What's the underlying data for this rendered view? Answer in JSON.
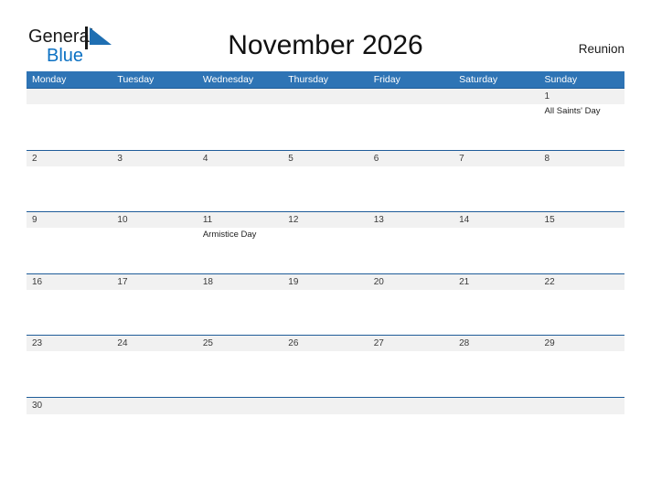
{
  "brand": {
    "word_one": "General",
    "word_two": "Blue",
    "flag_icon": "blue-flag-triangle-icon",
    "accent_dark": "#1a1a1a",
    "accent_blue": "#0c71c3"
  },
  "header": {
    "title": "November 2026",
    "region": "Reunion"
  },
  "theme": {
    "header_blue": "#2e74b5",
    "row_divider_blue": "#1f5c99",
    "date_band_gray": "#f1f1f1",
    "cell_white": "#ffffff",
    "date_text": "#3a3a3a",
    "event_text": "#222222"
  },
  "calendar": {
    "weekday_headers": [
      "Monday",
      "Tuesday",
      "Wednesday",
      "Thursday",
      "Friday",
      "Saturday",
      "Sunday"
    ],
    "weeks": [
      {
        "size": "tall",
        "days": [
          {
            "date": "",
            "event": ""
          },
          {
            "date": "",
            "event": ""
          },
          {
            "date": "",
            "event": ""
          },
          {
            "date": "",
            "event": ""
          },
          {
            "date": "",
            "event": ""
          },
          {
            "date": "",
            "event": ""
          },
          {
            "date": "1",
            "event": "All Saints' Day"
          }
        ]
      },
      {
        "size": "tall",
        "days": [
          {
            "date": "2",
            "event": ""
          },
          {
            "date": "3",
            "event": ""
          },
          {
            "date": "4",
            "event": ""
          },
          {
            "date": "5",
            "event": ""
          },
          {
            "date": "6",
            "event": ""
          },
          {
            "date": "7",
            "event": ""
          },
          {
            "date": "8",
            "event": ""
          }
        ]
      },
      {
        "size": "tall",
        "days": [
          {
            "date": "9",
            "event": ""
          },
          {
            "date": "10",
            "event": ""
          },
          {
            "date": "11",
            "event": "Armistice Day"
          },
          {
            "date": "12",
            "event": ""
          },
          {
            "date": "13",
            "event": ""
          },
          {
            "date": "14",
            "event": ""
          },
          {
            "date": "15",
            "event": ""
          }
        ]
      },
      {
        "size": "tall",
        "days": [
          {
            "date": "16",
            "event": ""
          },
          {
            "date": "17",
            "event": ""
          },
          {
            "date": "18",
            "event": ""
          },
          {
            "date": "19",
            "event": ""
          },
          {
            "date": "20",
            "event": ""
          },
          {
            "date": "21",
            "event": ""
          },
          {
            "date": "22",
            "event": ""
          }
        ]
      },
      {
        "size": "tall",
        "days": [
          {
            "date": "23",
            "event": ""
          },
          {
            "date": "24",
            "event": ""
          },
          {
            "date": "25",
            "event": ""
          },
          {
            "date": "26",
            "event": ""
          },
          {
            "date": "27",
            "event": ""
          },
          {
            "date": "28",
            "event": ""
          },
          {
            "date": "29",
            "event": ""
          }
        ]
      },
      {
        "size": "short",
        "days": [
          {
            "date": "30",
            "event": ""
          },
          {
            "date": "",
            "event": ""
          },
          {
            "date": "",
            "event": ""
          },
          {
            "date": "",
            "event": ""
          },
          {
            "date": "",
            "event": ""
          },
          {
            "date": "",
            "event": ""
          },
          {
            "date": "",
            "event": ""
          }
        ]
      }
    ]
  }
}
